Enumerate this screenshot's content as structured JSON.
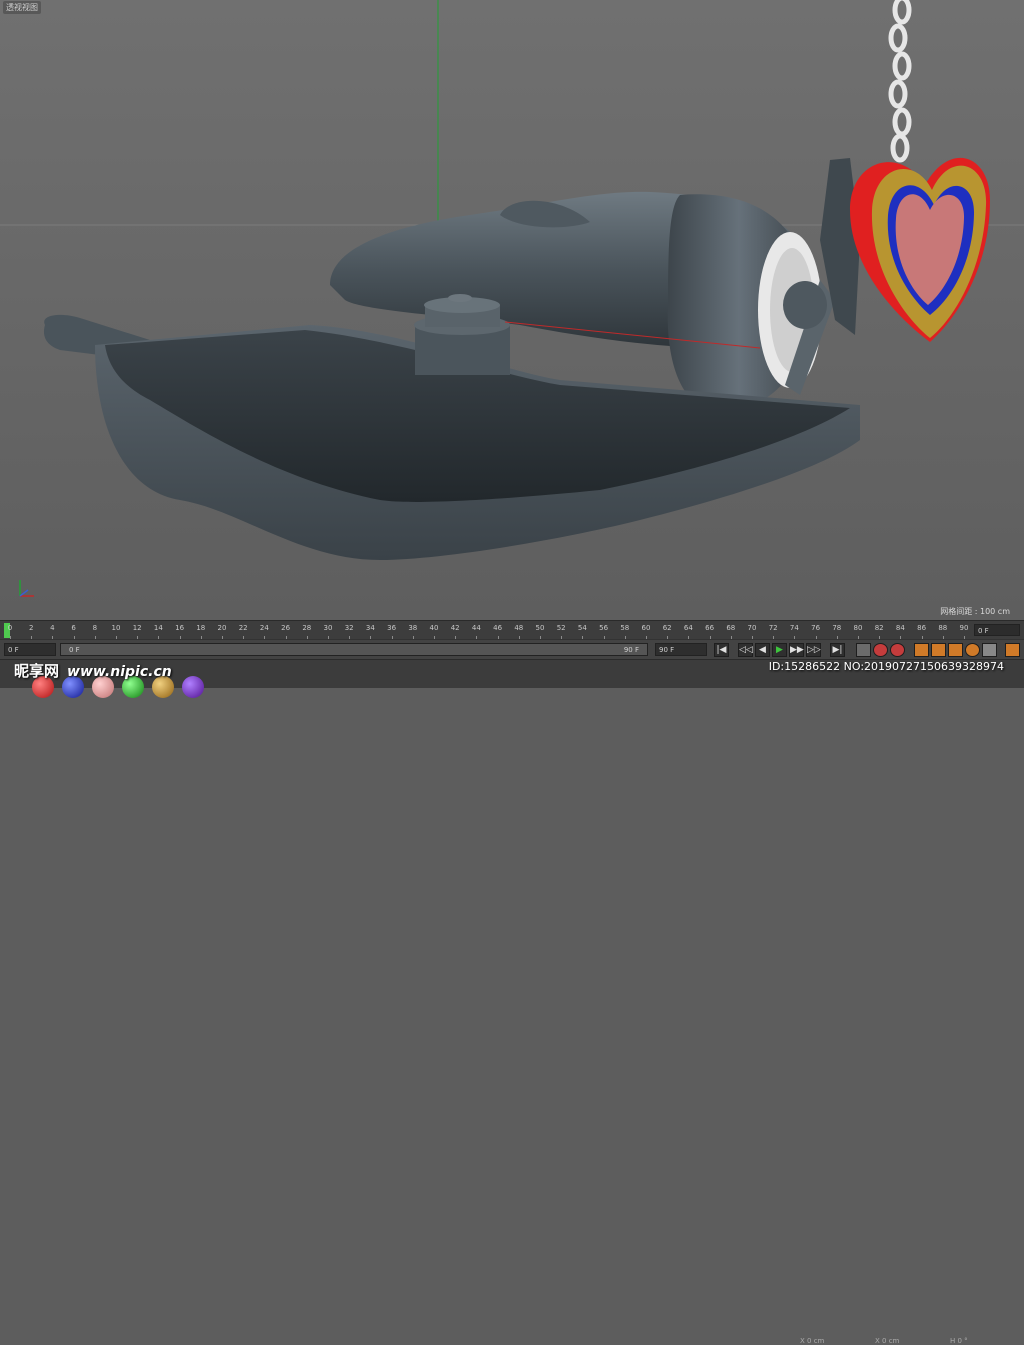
{
  "viewport": {
    "label": "透视视图",
    "grid_spacing": "网格间距 : 100 cm"
  },
  "timeline": {
    "ticks": [
      "0",
      "2",
      "4",
      "6",
      "8",
      "10",
      "12",
      "14",
      "16",
      "18",
      "20",
      "22",
      "24",
      "26",
      "28",
      "30",
      "32",
      "34",
      "36",
      "38",
      "40",
      "42",
      "44",
      "46",
      "48",
      "50",
      "52",
      "54",
      "56",
      "58",
      "60",
      "62",
      "64",
      "66",
      "68",
      "70",
      "72",
      "74",
      "76",
      "78",
      "80",
      "82",
      "84",
      "86",
      "88",
      "90"
    ],
    "current_frame": "0 F"
  },
  "transport": {
    "start_frame": "0 F",
    "slider_min": "0 F",
    "slider_max": "90 F",
    "end_frame": "90 F",
    "buttons": [
      "|◀",
      "◁◁",
      "◀",
      "▶",
      "▶▶",
      "▷▷",
      "▶|"
    ]
  },
  "watermark": {
    "brand": "昵享网",
    "site": "www.nipic.cn",
    "image_id": "ID:15286522 NO:20190727150639328974"
  },
  "coords": [
    "X  0 cm",
    "X  0 cm",
    "H  0 °"
  ],
  "colors": {
    "playhead": "#4fc94f",
    "play_button": "#3ec63e",
    "y_axis": "#23a035",
    "x_axis": "#c02a2a"
  }
}
